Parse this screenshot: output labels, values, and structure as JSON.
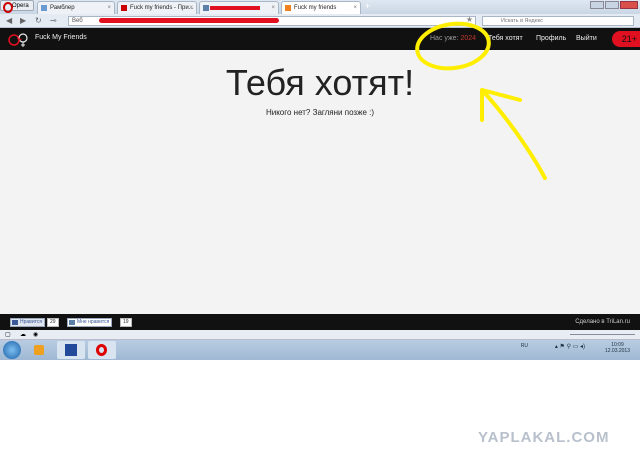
{
  "browser": {
    "menu_label": "Opera",
    "tabs": [
      {
        "label": "Рамблер"
      },
      {
        "label": "Fuck my friends - При..."
      },
      {
        "label": ""
      },
      {
        "label": "Fuck my friends"
      }
    ],
    "address_prefix": "Веб",
    "search_placeholder": "Искать в Яндекс"
  },
  "site": {
    "brand": "Fuck My Friends",
    "counter_label": "Нас уже:",
    "counter_value": "2024",
    "nav": [
      {
        "label": "Тебя хотят"
      },
      {
        "label": "Профиль"
      },
      {
        "label": "Выйти"
      }
    ],
    "age_badge": "21+",
    "title": "Тебя хотят!",
    "message": "Никого нет? Загляни позже :)",
    "footer": {
      "fb_like": "Нравится",
      "fb_count": "29",
      "vk_like": "Мне нравится",
      "vk_count": "19",
      "credit": "Сделано в TriLan.ru"
    }
  },
  "taskbar": {
    "lang": "RU",
    "time": "10:09",
    "date": "12.03.2013"
  },
  "watermark": "YAPLAKAL.COM",
  "colors": {
    "accent": "#e01020",
    "annotation": "#ffee00",
    "counter": "#c0392b"
  }
}
